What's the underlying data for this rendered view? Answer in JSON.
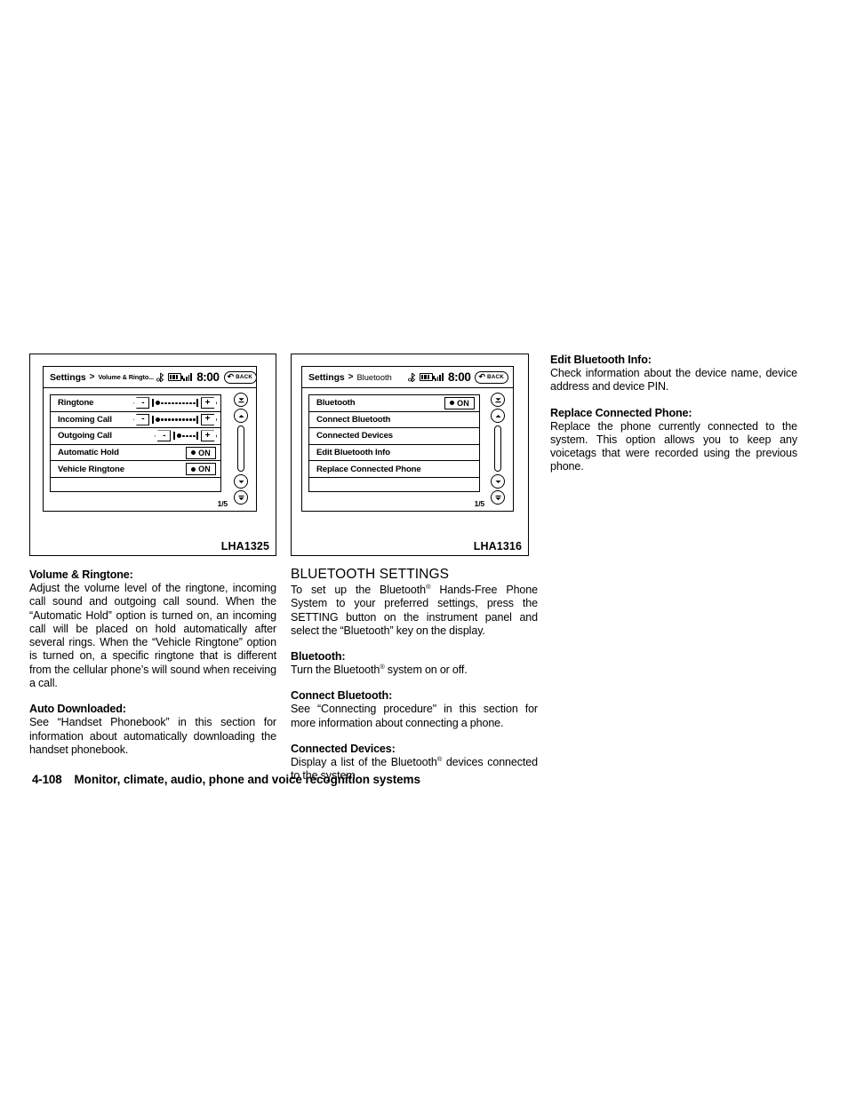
{
  "figures": {
    "left": {
      "code": "LHA1325",
      "screen": {
        "title": "Settings",
        "separator": ">",
        "breadcrumb": "Volume & Ringto...",
        "clock": "8:00",
        "back_label": "BACK",
        "back_arrow": "↶",
        "page_indicator": "1/5",
        "rows": [
          {
            "label": "Ringtone",
            "type": "volume",
            "minus": "-",
            "plus": "+",
            "dots": 11
          },
          {
            "label": "Incoming Call",
            "type": "volume",
            "minus": "-",
            "plus": "+",
            "dots": 11
          },
          {
            "label": "Outgoing Call",
            "type": "volume",
            "minus": "-",
            "plus": "+",
            "dots": 5
          },
          {
            "label": "Automatic Hold",
            "type": "toggle",
            "state": "ON"
          },
          {
            "label": "Vehicle Ringtone",
            "type": "toggle",
            "state": "ON"
          }
        ]
      }
    },
    "mid": {
      "code": "LHA1316",
      "screen": {
        "title": "Settings",
        "separator": ">",
        "breadcrumb": "Bluetooth",
        "clock": "8:00",
        "back_label": "BACK",
        "back_arrow": "↶",
        "page_indicator": "1/5",
        "rows": [
          {
            "label": "Bluetooth",
            "type": "toggle",
            "state": "ON"
          },
          {
            "label": "Connect Bluetooth",
            "type": "plain"
          },
          {
            "label": "Connected Devices",
            "type": "plain"
          },
          {
            "label": "Edit Bluetooth Info",
            "type": "plain"
          },
          {
            "label": "Replace Connected Phone",
            "type": "plain"
          }
        ]
      }
    }
  },
  "left_column": {
    "heading1": "Volume & Ringtone:",
    "para1": "Adjust the volume level of the ringtone, incoming call sound and outgoing call sound. When the “Automatic Hold” option is turned on, an incoming call will be placed on hold automatically after several rings. When the “Vehicle Ringtone” option is turned on, a specific ringtone that is different from the cellular phone’s will sound when receiving a call.",
    "heading2": "Auto Downloaded:",
    "para2": "See “Handset Phonebook” in this section for information about automatically downloading the handset phonebook."
  },
  "mid_column": {
    "section_title": "BLUETOOTH SETTINGS",
    "para1_a": "To set up the Bluetooth",
    "para1_sup": "®",
    "para1_b": " Hands-Free Phone System to your preferred settings, press the SETTING button on the instrument panel and select the “Bluetooth” key on the display.",
    "heading1": "Bluetooth:",
    "para2_a": "Turn the Bluetooth",
    "para2_sup": "®",
    "para2_b": " system on or off.",
    "heading2": "Connect Bluetooth:",
    "para3": "See “Connecting procedure\" in this section for more information about connecting a phone.",
    "heading3": "Connected Devices:",
    "para4_a": "Display a list of the Bluetooth",
    "para4_sup": "®",
    "para4_b": " devices connected to the system."
  },
  "right_column": {
    "heading1": "Edit Bluetooth Info:",
    "para1": "Check information about the device name, device address and device PIN.",
    "heading2": "Replace Connected Phone:",
    "para2": "Replace the phone currently connected to the system. This option allows you to keep any voicetags that were recorded using the previous phone."
  },
  "footer": {
    "page_number": "4-108",
    "title": "Monitor, climate, audio, phone and voice recognition systems"
  }
}
